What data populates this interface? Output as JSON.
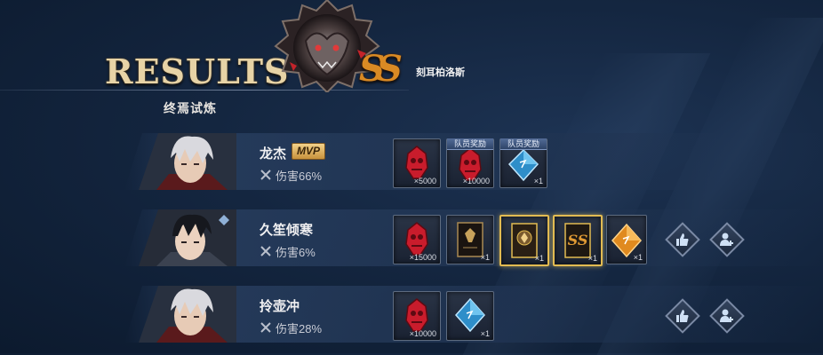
{
  "header": {
    "title": "RESULTS",
    "subtitle": "终焉试炼",
    "boss_name": "刻耳柏洛斯",
    "grade": "SS",
    "boss_icon": "cerberus-emblem-icon"
  },
  "players": [
    {
      "name": "龙杰",
      "mvp_label": "MVP",
      "damage_label": "伤害66%",
      "damage_pct": 66,
      "rewards": [
        {
          "icon": "red-gem-icon",
          "qty": "×5000",
          "tag": ""
        },
        {
          "icon": "red-gem-icon",
          "qty": "×10000",
          "tag": "队员奖励"
        },
        {
          "icon": "blue-crystal-icon",
          "qty": "×1",
          "tag": "队员奖励"
        }
      ]
    },
    {
      "name": "久笙倾寒",
      "mvp_label": "",
      "damage_label": "伤害6%",
      "damage_pct": 6,
      "rewards": [
        {
          "icon": "red-gem-icon",
          "qty": "×15000",
          "tag": ""
        },
        {
          "icon": "dark-card-icon",
          "qty": "×1",
          "tag": ""
        },
        {
          "icon": "gold-card-icon",
          "qty": "×1",
          "tag": ""
        },
        {
          "icon": "ss-card-icon",
          "qty": "×1",
          "tag": ""
        },
        {
          "icon": "orange-crystal-icon",
          "qty": "×1",
          "tag": ""
        }
      ]
    },
    {
      "name": "拎壶冲",
      "mvp_label": "",
      "damage_label": "伤害28%",
      "damage_pct": 28,
      "rewards": [
        {
          "icon": "red-gem-icon",
          "qty": "×10000",
          "tag": ""
        },
        {
          "icon": "blue-crystal-icon",
          "qty": "×1",
          "tag": ""
        }
      ]
    }
  ],
  "actions": {
    "like_icon": "thumbs-up-icon",
    "add_friend_icon": "add-friend-icon"
  },
  "colors": {
    "title_gold": "#e7d3a6",
    "grade_orange": "#d98a24",
    "mvp_gold": "#c8923d",
    "highlight_border": "#e2bb52"
  }
}
